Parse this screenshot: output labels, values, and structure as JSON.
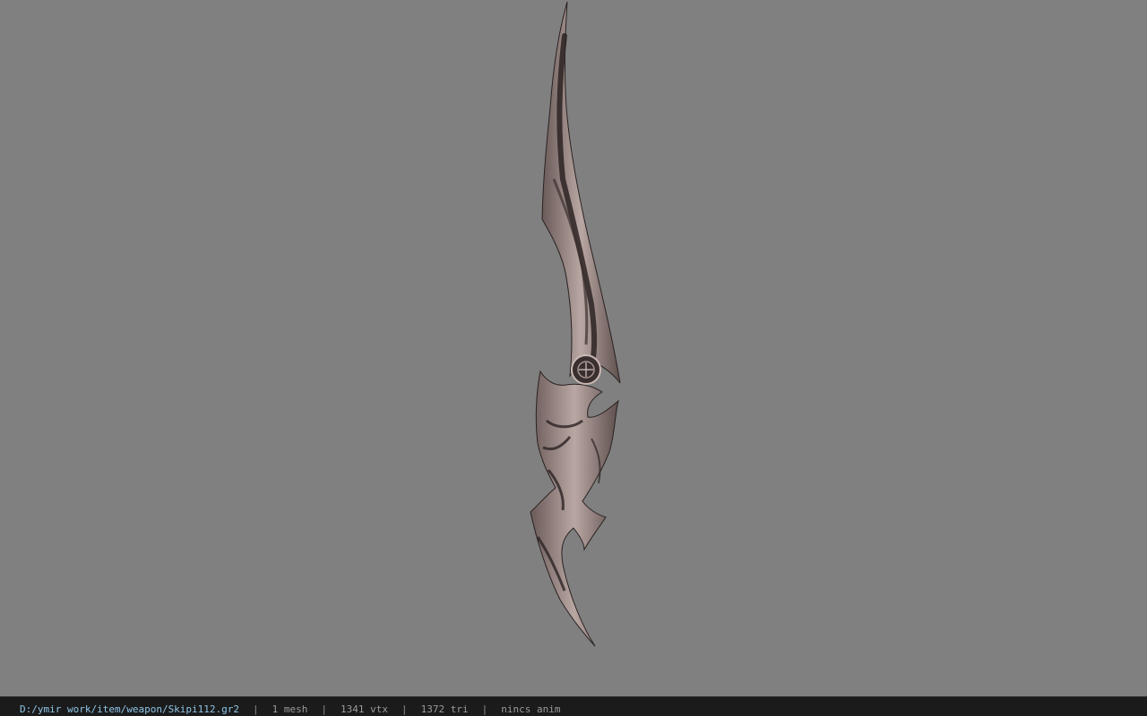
{
  "viewer": {
    "background_color": "#808080",
    "model_icon": "curved-blade-weapon-model"
  },
  "status_bar": {
    "file_path": "D:/ymir work/item/weapon/Skipi112.gr2",
    "mesh_count": "1 mesh",
    "vertex_count": "1341 vtx",
    "triangle_count": "1372 tri",
    "animation": "nincs anim",
    "separator": "|",
    "path_color": "#8fc6e8"
  }
}
